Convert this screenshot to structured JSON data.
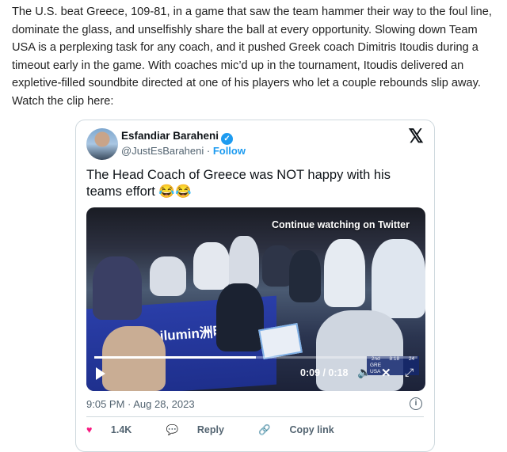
{
  "article": {
    "paragraph": "The U.S. beat Greece, 109-81, in a game that saw the team hammer their way to the foul line, dominate the glass, and unselfishly share the ball at every opportunity. Slowing down Team USA is a perplexing task for any coach, and it pushed Greek coach Dimitris Itoudis during a timeout early in the game. With coaches mic’d up in the tournament, Itoudis delivered an expletive-filled soundbite directed at one of his players who let a couple rebounds slip away. Watch the clip here:"
  },
  "tweet": {
    "author_name": "Esfandiar Baraheni",
    "handle": "@JustEsBaraheni",
    "separator": " · ",
    "follow_label": "Follow",
    "x_logo": "𝕏",
    "text": "The Head Coach of Greece was NOT happy with his teams effort 😂😂",
    "video": {
      "continue_label": "Continue watching on Twitter",
      "time": "0:09 / 0:18",
      "progress": 0.5,
      "banner_text": "Unilumin洲明",
      "scorebug": {
        "period": "2nd",
        "clock": "8:18",
        "shot": "24",
        "team1": "GRE",
        "team2": "USA"
      }
    },
    "timestamp": "9:05 PM · Aug 28, 2023",
    "actions": {
      "likes": "1.4K",
      "reply": "Reply",
      "copy": "Copy link"
    },
    "colors": {
      "accent": "#1d9bf0",
      "heart": "#f91880"
    },
    "icons": [
      "verified-badge-icon",
      "x-logo-icon",
      "play-icon",
      "volume-icon",
      "fullscreen-icon",
      "info-icon",
      "heart-icon",
      "reply-icon",
      "link-icon"
    ]
  }
}
